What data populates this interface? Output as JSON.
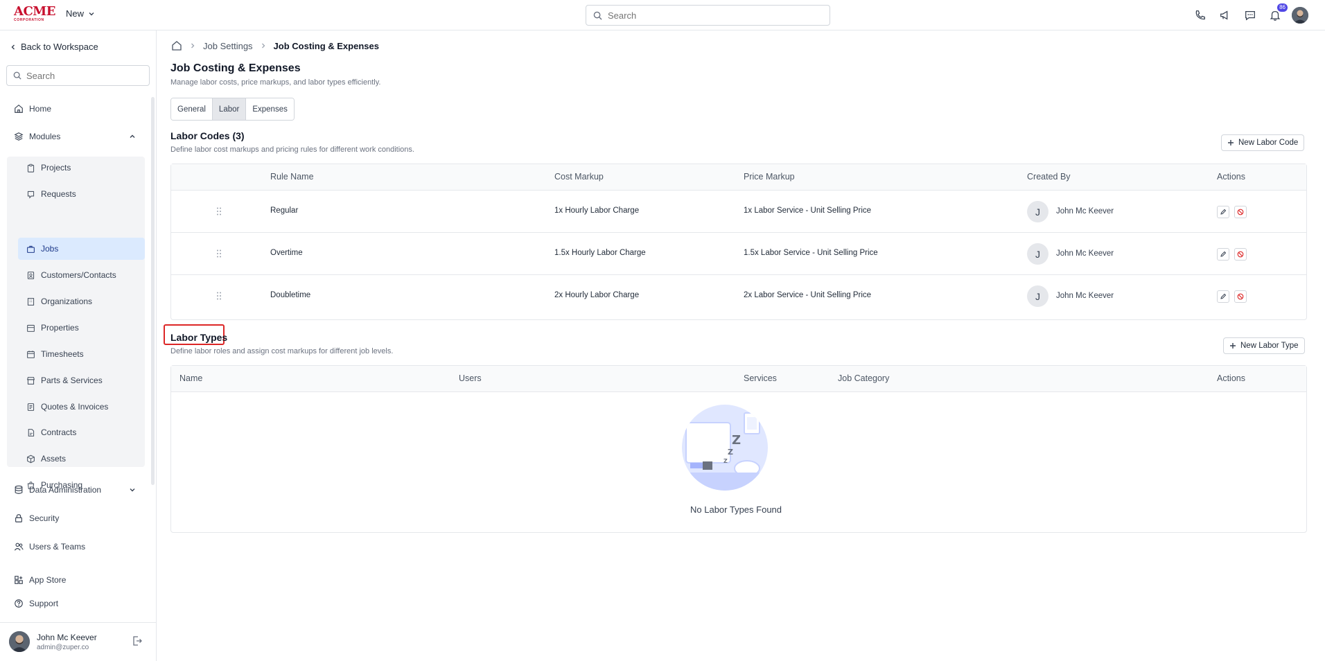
{
  "topbar": {
    "logo_text": "ACME",
    "logo_sub": "CORPORATION",
    "new_label": "New",
    "search_placeholder": "Search",
    "notification_count": "86"
  },
  "sidebar": {
    "back_label": "Back to Workspace",
    "search_placeholder": "Search",
    "home": "Home",
    "modules": "Modules",
    "module_items": [
      "Projects",
      "Requests",
      "Jobs",
      "Customers/Contacts",
      "Organizations",
      "Properties",
      "Timesheets",
      "Parts & Services",
      "Quotes & Invoices",
      "Contracts",
      "Assets",
      "Purchasing"
    ],
    "data_admin": "Data Administration",
    "security": "Security",
    "users_teams": "Users & Teams",
    "app_store": "App Store",
    "support": "Support",
    "user_name": "John Mc Keever",
    "user_email": "admin@zuper.co"
  },
  "breadcrumb": {
    "level1": "Job Settings",
    "current": "Job Costing & Expenses"
  },
  "page": {
    "title": "Job Costing & Expenses",
    "subtitle": "Manage labor costs, price markups, and labor types efficiently.",
    "tabs": [
      "General",
      "Labor",
      "Expenses"
    ]
  },
  "labor_codes": {
    "title": "Labor Codes (3)",
    "subtitle": "Define labor cost markups and pricing rules for different work conditions.",
    "new_button": "New Labor Code",
    "columns": [
      "Rule Name",
      "Cost Markup",
      "Price Markup",
      "Created By",
      "Actions"
    ],
    "rows": [
      {
        "rule": "Regular",
        "cost": "1x Hourly Labor Charge",
        "price": "1x Labor Service - Unit Selling Price",
        "initial": "J",
        "creator": "John Mc Keever"
      },
      {
        "rule": "Overtime",
        "cost": "1.5x Hourly Labor Charge",
        "price": "1.5x Labor Service - Unit Selling Price",
        "initial": "J",
        "creator": "John Mc Keever"
      },
      {
        "rule": "Doubletime",
        "cost": "2x Hourly Labor Charge",
        "price": "2x Labor Service - Unit Selling Price",
        "initial": "J",
        "creator": "John Mc Keever"
      }
    ]
  },
  "labor_types": {
    "title": "Labor Types",
    "subtitle": "Define labor roles and assign cost markups for different job levels.",
    "new_button": "New Labor Type",
    "columns": [
      "Name",
      "Users",
      "Services",
      "Job Category",
      "Actions"
    ],
    "empty_text": "No Labor Types Found"
  },
  "colors": {
    "accent": "#4f46e5",
    "active_nav": "#dbeafe",
    "highlight": "#dc2626",
    "brand": "#c8102e"
  }
}
